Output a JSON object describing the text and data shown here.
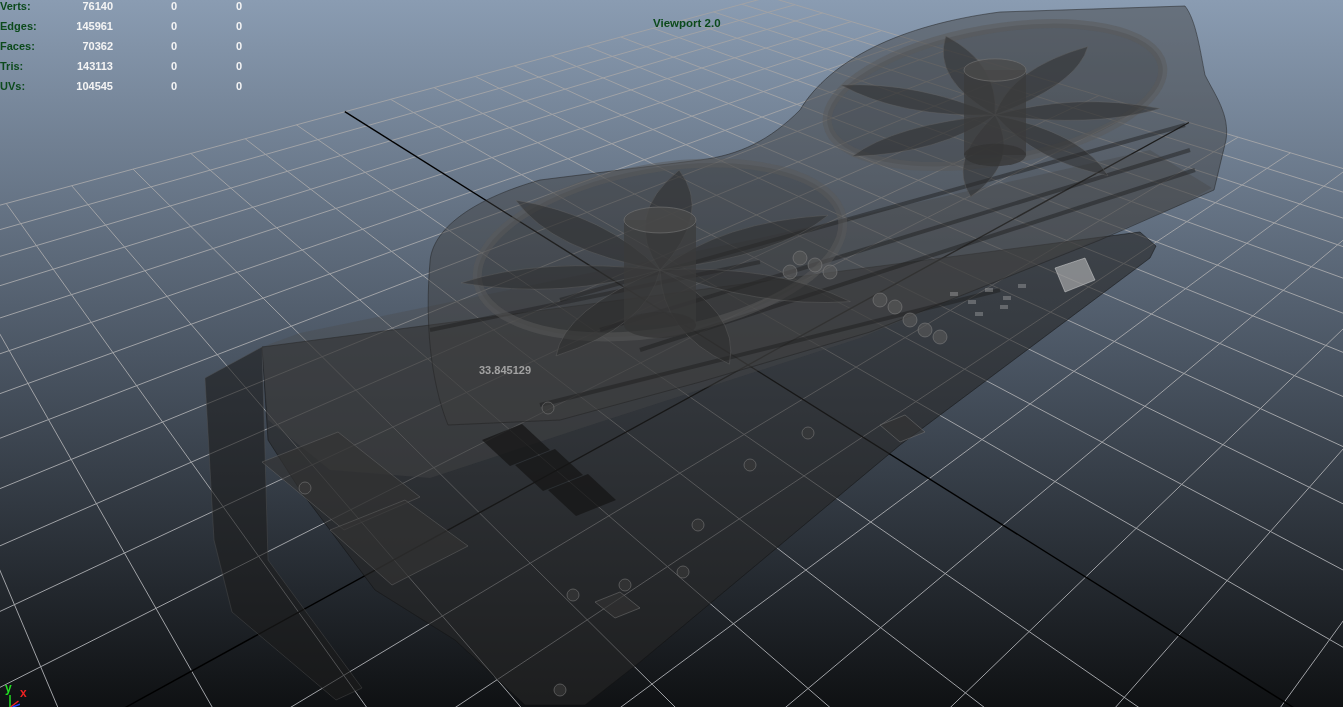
{
  "poly_count": [
    {
      "label": "Verts:",
      "values": [
        "76140",
        "0",
        "0"
      ]
    },
    {
      "label": "Edges:",
      "values": [
        "145961",
        "0",
        "0"
      ]
    },
    {
      "label": "Faces:",
      "values": [
        "70362",
        "0",
        "0"
      ]
    },
    {
      "label": "Tris:",
      "values": [
        "143113",
        "0",
        "0"
      ]
    },
    {
      "label": "UVs:",
      "values": [
        "104545",
        "0",
        "0"
      ]
    }
  ],
  "viewport": {
    "label": "Viewport 2.0",
    "measurement": "33.845129"
  },
  "axis_gizmo": {
    "axes": [
      {
        "label": "y",
        "color": "#22dd22"
      },
      {
        "label": "x",
        "color": "#ee2222"
      }
    ]
  }
}
